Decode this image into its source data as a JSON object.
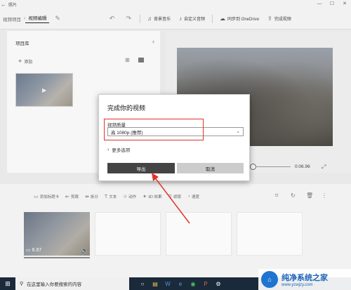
{
  "app": {
    "title": "照片"
  },
  "toolbar": {
    "crumb_project": "视频项目",
    "crumb_editor": "视频编辑",
    "bg_music": "背景音乐",
    "custom_audio": "自定义音频",
    "sync_onedrive": "同步到 OneDrive",
    "finish_video": "完成视频"
  },
  "library": {
    "title": "项目库",
    "add_label": "添加"
  },
  "preview": {
    "time": "0:06.96"
  },
  "storyboard": {
    "add_title_card": "添加标题卡",
    "trim": "剪裁",
    "split": "拆分",
    "text": "文本",
    "motion": "动作",
    "effects_3d": "3D 效果",
    "filters": "滤镜",
    "speed": "速度",
    "clip_duration": "6.97"
  },
  "dialog": {
    "title": "完成你的视频",
    "quality_label": "视频质量",
    "quality_value": "高 1080p (推荐)",
    "more_options": "更多选项",
    "export_label": "导出",
    "cancel_label": "取消"
  },
  "taskbar": {
    "search_placeholder": "在这里输入你要搜索的内容"
  },
  "watermark": {
    "name": "纯净系统之家",
    "url": "www.ycwjzy.com"
  },
  "colors": {
    "highlight": "#e0322c",
    "export_button": "#444444",
    "watermark": "#1a63b8"
  }
}
